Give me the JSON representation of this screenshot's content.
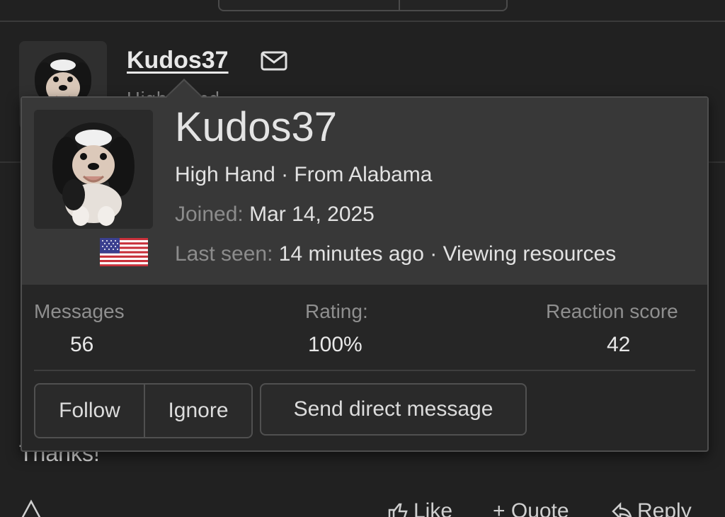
{
  "post": {
    "username": "Kudos37",
    "title_peek": "High Hand",
    "body_text": "Thanks!",
    "actions": {
      "like": "Like",
      "quote": "+ Quote",
      "reply": "Reply"
    }
  },
  "card": {
    "name": "Kudos37",
    "title_line": "High Hand · From Alabama",
    "joined_label": "Joined:",
    "joined_value": "Mar 14, 2025",
    "last_seen_label": "Last seen:",
    "last_seen_value": "14 minutes ago · Viewing resources",
    "flag": "us-flag-icon",
    "stats": [
      {
        "label": "Messages",
        "value": "56"
      },
      {
        "label": "Rating:",
        "value": "100%"
      },
      {
        "label": "Reaction score",
        "value": "42"
      }
    ],
    "buttons": {
      "follow": "Follow",
      "ignore": "Ignore",
      "direct_message": "Send direct message"
    }
  },
  "colors": {
    "background": "#212121",
    "card_top": "#383838",
    "card_body": "#262626",
    "muted_text": "#8c8c8c"
  }
}
